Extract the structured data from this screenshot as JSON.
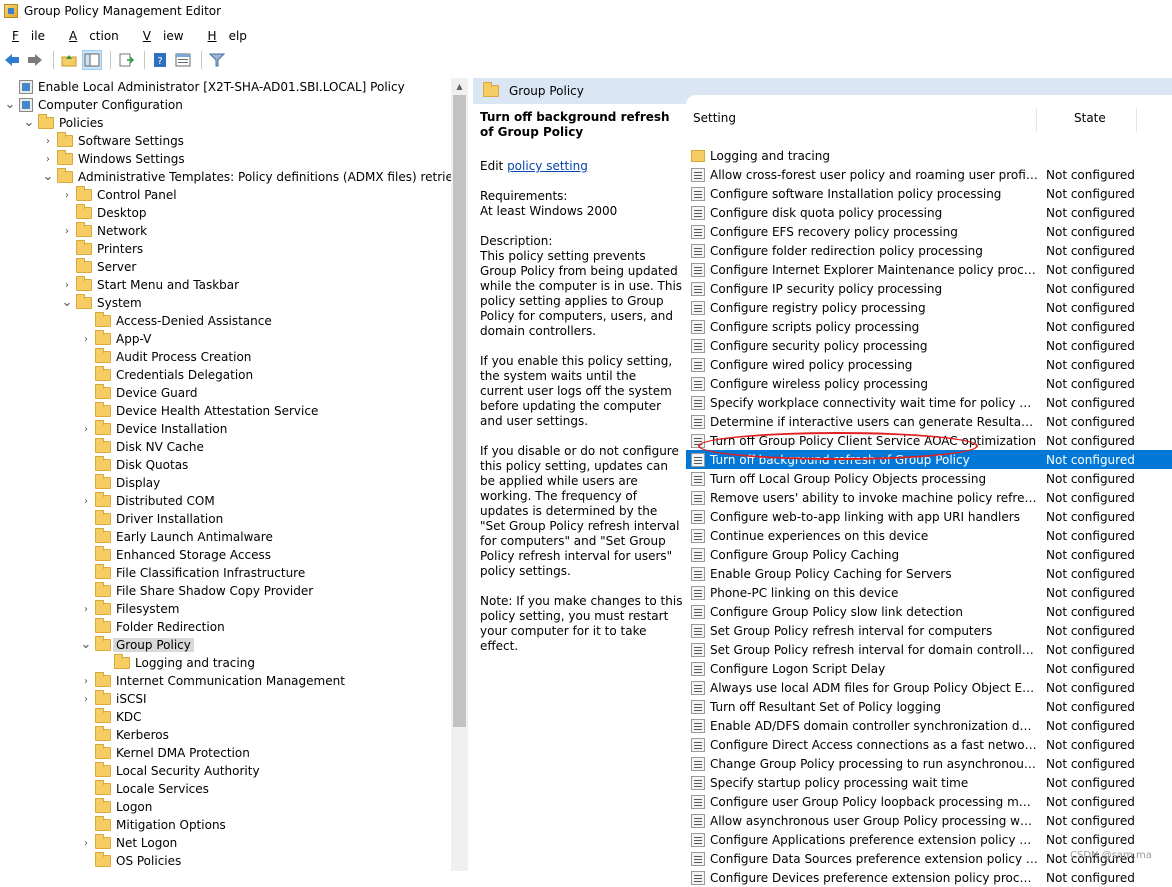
{
  "window": {
    "title": "Group Policy Management Editor"
  },
  "menu": [
    {
      "label_pre": "",
      "label_u": "F",
      "label_post": "ile"
    },
    {
      "label_pre": "",
      "label_u": "A",
      "label_post": "ction"
    },
    {
      "label_pre": "",
      "label_u": "V",
      "label_post": "iew"
    },
    {
      "label_pre": "",
      "label_u": "H",
      "label_post": "elp"
    }
  ],
  "toolbar": [
    "back-icon",
    "forward-icon",
    "up-folder-icon",
    "show-hide-tree-icon",
    "export-list-icon",
    "help-icon",
    "properties-icon",
    "filter-icon"
  ],
  "tree": [
    {
      "label": "Enable Local Administrator [X2T-SHA-AD01.SBI.LOCAL] Policy",
      "level": 0,
      "chev": "",
      "icon": "policy"
    },
    {
      "label": "Computer Configuration",
      "level": 0,
      "chev": "open",
      "icon": "policy"
    },
    {
      "label": "Policies",
      "level": 1,
      "chev": "open",
      "icon": "folder"
    },
    {
      "label": "Software Settings",
      "level": 2,
      "chev": "closed",
      "icon": "folder"
    },
    {
      "label": "Windows Settings",
      "level": 2,
      "chev": "closed",
      "icon": "folder"
    },
    {
      "label": "Administrative Templates: Policy definitions (ADMX files) retrieved fror",
      "level": 2,
      "chev": "open",
      "icon": "folder"
    },
    {
      "label": "Control Panel",
      "level": 3,
      "chev": "closed",
      "icon": "folder"
    },
    {
      "label": "Desktop",
      "level": 3,
      "chev": "",
      "icon": "folder"
    },
    {
      "label": "Network",
      "level": 3,
      "chev": "closed",
      "icon": "folder"
    },
    {
      "label": "Printers",
      "level": 3,
      "chev": "",
      "icon": "folder"
    },
    {
      "label": "Server",
      "level": 3,
      "chev": "",
      "icon": "folder"
    },
    {
      "label": "Start Menu and Taskbar",
      "level": 3,
      "chev": "closed",
      "icon": "folder"
    },
    {
      "label": "System",
      "level": 3,
      "chev": "open",
      "icon": "folder"
    },
    {
      "label": "Access-Denied Assistance",
      "level": 4,
      "chev": "",
      "icon": "folder"
    },
    {
      "label": "App-V",
      "level": 4,
      "chev": "closed",
      "icon": "folder"
    },
    {
      "label": "Audit Process Creation",
      "level": 4,
      "chev": "",
      "icon": "folder"
    },
    {
      "label": "Credentials Delegation",
      "level": 4,
      "chev": "",
      "icon": "folder"
    },
    {
      "label": "Device Guard",
      "level": 4,
      "chev": "",
      "icon": "folder"
    },
    {
      "label": "Device Health Attestation Service",
      "level": 4,
      "chev": "",
      "icon": "folder"
    },
    {
      "label": "Device Installation",
      "level": 4,
      "chev": "closed",
      "icon": "folder"
    },
    {
      "label": "Disk NV Cache",
      "level": 4,
      "chev": "",
      "icon": "folder"
    },
    {
      "label": "Disk Quotas",
      "level": 4,
      "chev": "",
      "icon": "folder"
    },
    {
      "label": "Display",
      "level": 4,
      "chev": "",
      "icon": "folder"
    },
    {
      "label": "Distributed COM",
      "level": 4,
      "chev": "closed",
      "icon": "folder"
    },
    {
      "label": "Driver Installation",
      "level": 4,
      "chev": "",
      "icon": "folder"
    },
    {
      "label": "Early Launch Antimalware",
      "level": 4,
      "chev": "",
      "icon": "folder"
    },
    {
      "label": "Enhanced Storage Access",
      "level": 4,
      "chev": "",
      "icon": "folder"
    },
    {
      "label": "File Classification Infrastructure",
      "level": 4,
      "chev": "",
      "icon": "folder"
    },
    {
      "label": "File Share Shadow Copy Provider",
      "level": 4,
      "chev": "",
      "icon": "folder"
    },
    {
      "label": "Filesystem",
      "level": 4,
      "chev": "closed",
      "icon": "folder"
    },
    {
      "label": "Folder Redirection",
      "level": 4,
      "chev": "",
      "icon": "folder"
    },
    {
      "label": "Group Policy",
      "level": 4,
      "chev": "open",
      "icon": "folder",
      "selected": true
    },
    {
      "label": "Logging and tracing",
      "level": 5,
      "chev": "",
      "icon": "folder"
    },
    {
      "label": "Internet Communication Management",
      "level": 4,
      "chev": "closed",
      "icon": "folder"
    },
    {
      "label": "iSCSI",
      "level": 4,
      "chev": "closed",
      "icon": "folder"
    },
    {
      "label": "KDC",
      "level": 4,
      "chev": "",
      "icon": "folder"
    },
    {
      "label": "Kerberos",
      "level": 4,
      "chev": "",
      "icon": "folder"
    },
    {
      "label": "Kernel DMA Protection",
      "level": 4,
      "chev": "",
      "icon": "folder"
    },
    {
      "label": "Local Security Authority",
      "level": 4,
      "chev": "",
      "icon": "folder"
    },
    {
      "label": "Locale Services",
      "level": 4,
      "chev": "",
      "icon": "folder"
    },
    {
      "label": "Logon",
      "level": 4,
      "chev": "",
      "icon": "folder"
    },
    {
      "label": "Mitigation Options",
      "level": 4,
      "chev": "",
      "icon": "folder"
    },
    {
      "label": "Net Logon",
      "level": 4,
      "chev": "closed",
      "icon": "folder"
    },
    {
      "label": "OS Policies",
      "level": 4,
      "chev": "",
      "icon": "folder"
    }
  ],
  "right_header": {
    "title": "Group Policy"
  },
  "description": {
    "title": "Turn off background refresh of Group Policy",
    "edit_prefix": "Edit ",
    "edit_link": "policy setting ",
    "requirements_label": "Requirements:",
    "requirements_value": "At least Windows 2000",
    "description_label": "Description:",
    "p1": "This policy setting prevents Group Policy from being updated while the computer is in use. This policy setting applies to Group Policy for computers, users, and domain controllers.",
    "p2": "If you enable this policy setting, the system waits until the current user logs off the system before updating the computer and user settings.",
    "p3": "If you disable or do not configure this policy setting, updates can be applied while users are working. The frequency of updates is determined by the \"Set Group Policy refresh interval for computers\" and \"Set Group Policy refresh interval for users\" policy settings.",
    "p4": "Note: If you make changes to this policy setting, you must restart your computer for it to take effect."
  },
  "list": {
    "col_setting": "Setting",
    "col_state": "State",
    "rows": [
      {
        "setting": "Logging and tracing",
        "state": "",
        "folder": true
      },
      {
        "setting": "Allow cross-forest user policy and roaming user profiles",
        "state": "Not configured"
      },
      {
        "setting": "Configure software Installation policy processing",
        "state": "Not configured"
      },
      {
        "setting": "Configure disk quota policy processing",
        "state": "Not configured"
      },
      {
        "setting": "Configure EFS recovery policy processing",
        "state": "Not configured"
      },
      {
        "setting": "Configure folder redirection policy processing",
        "state": "Not configured"
      },
      {
        "setting": "Configure Internet Explorer Maintenance policy processing",
        "state": "Not configured"
      },
      {
        "setting": "Configure IP security policy processing",
        "state": "Not configured"
      },
      {
        "setting": "Configure registry policy processing",
        "state": "Not configured"
      },
      {
        "setting": "Configure scripts policy processing",
        "state": "Not configured"
      },
      {
        "setting": "Configure security policy processing",
        "state": "Not configured"
      },
      {
        "setting": "Configure wired policy processing",
        "state": "Not configured"
      },
      {
        "setting": "Configure wireless policy processing",
        "state": "Not configured"
      },
      {
        "setting": "Specify workplace connectivity wait time for policy processi...",
        "state": "Not configured"
      },
      {
        "setting": "Determine if interactive users can generate Resultant Set of ...",
        "state": "Not configured"
      },
      {
        "setting": "Turn off Group Policy Client Service AOAC optimization",
        "state": "Not configured"
      },
      {
        "setting": "Turn off background refresh of Group Policy",
        "state": "Not configured",
        "selected": true
      },
      {
        "setting": "Turn off Local Group Policy Objects processing",
        "state": "Not configured"
      },
      {
        "setting": "Remove users' ability to invoke machine policy refresh",
        "state": "Not configured"
      },
      {
        "setting": "Configure web-to-app linking with app URI handlers",
        "state": "Not configured"
      },
      {
        "setting": "Continue experiences on this device",
        "state": "Not configured"
      },
      {
        "setting": "Configure Group Policy Caching",
        "state": "Not configured"
      },
      {
        "setting": "Enable Group Policy Caching for Servers",
        "state": "Not configured"
      },
      {
        "setting": "Phone-PC linking on this device",
        "state": "Not configured"
      },
      {
        "setting": "Configure Group Policy slow link detection",
        "state": "Not configured"
      },
      {
        "setting": "Set Group Policy refresh interval for computers",
        "state": "Not configured"
      },
      {
        "setting": "Set Group Policy refresh interval for domain controllers",
        "state": "Not configured"
      },
      {
        "setting": "Configure Logon Script Delay",
        "state": "Not configured"
      },
      {
        "setting": "Always use local ADM files for Group Policy Object Editor",
        "state": "Not configured"
      },
      {
        "setting": "Turn off Resultant Set of Policy logging",
        "state": "Not configured"
      },
      {
        "setting": "Enable AD/DFS domain controller synchronization during p...",
        "state": "Not configured"
      },
      {
        "setting": "Configure Direct Access connections as a fast network conn...",
        "state": "Not configured"
      },
      {
        "setting": "Change Group Policy processing to run asynchronously wh...",
        "state": "Not configured"
      },
      {
        "setting": "Specify startup policy processing wait time",
        "state": "Not configured"
      },
      {
        "setting": "Configure user Group Policy loopback processing mode",
        "state": "Not configured"
      },
      {
        "setting": "Allow asynchronous user Group Policy processing when log...",
        "state": "Not configured"
      },
      {
        "setting": "Configure Applications preference extension policy processi...",
        "state": "Not configured"
      },
      {
        "setting": "Configure Data Sources preference extension policy processi...",
        "state": "Not configured"
      },
      {
        "setting": "Configure Devices preference extension policy processing",
        "state": "Not configured"
      }
    ]
  },
  "watermark": "CSDN @sam.ma",
  "colors": {
    "selection": "#0078d7",
    "header_band": "#dbe6f4",
    "annotation": "#e02020"
  }
}
